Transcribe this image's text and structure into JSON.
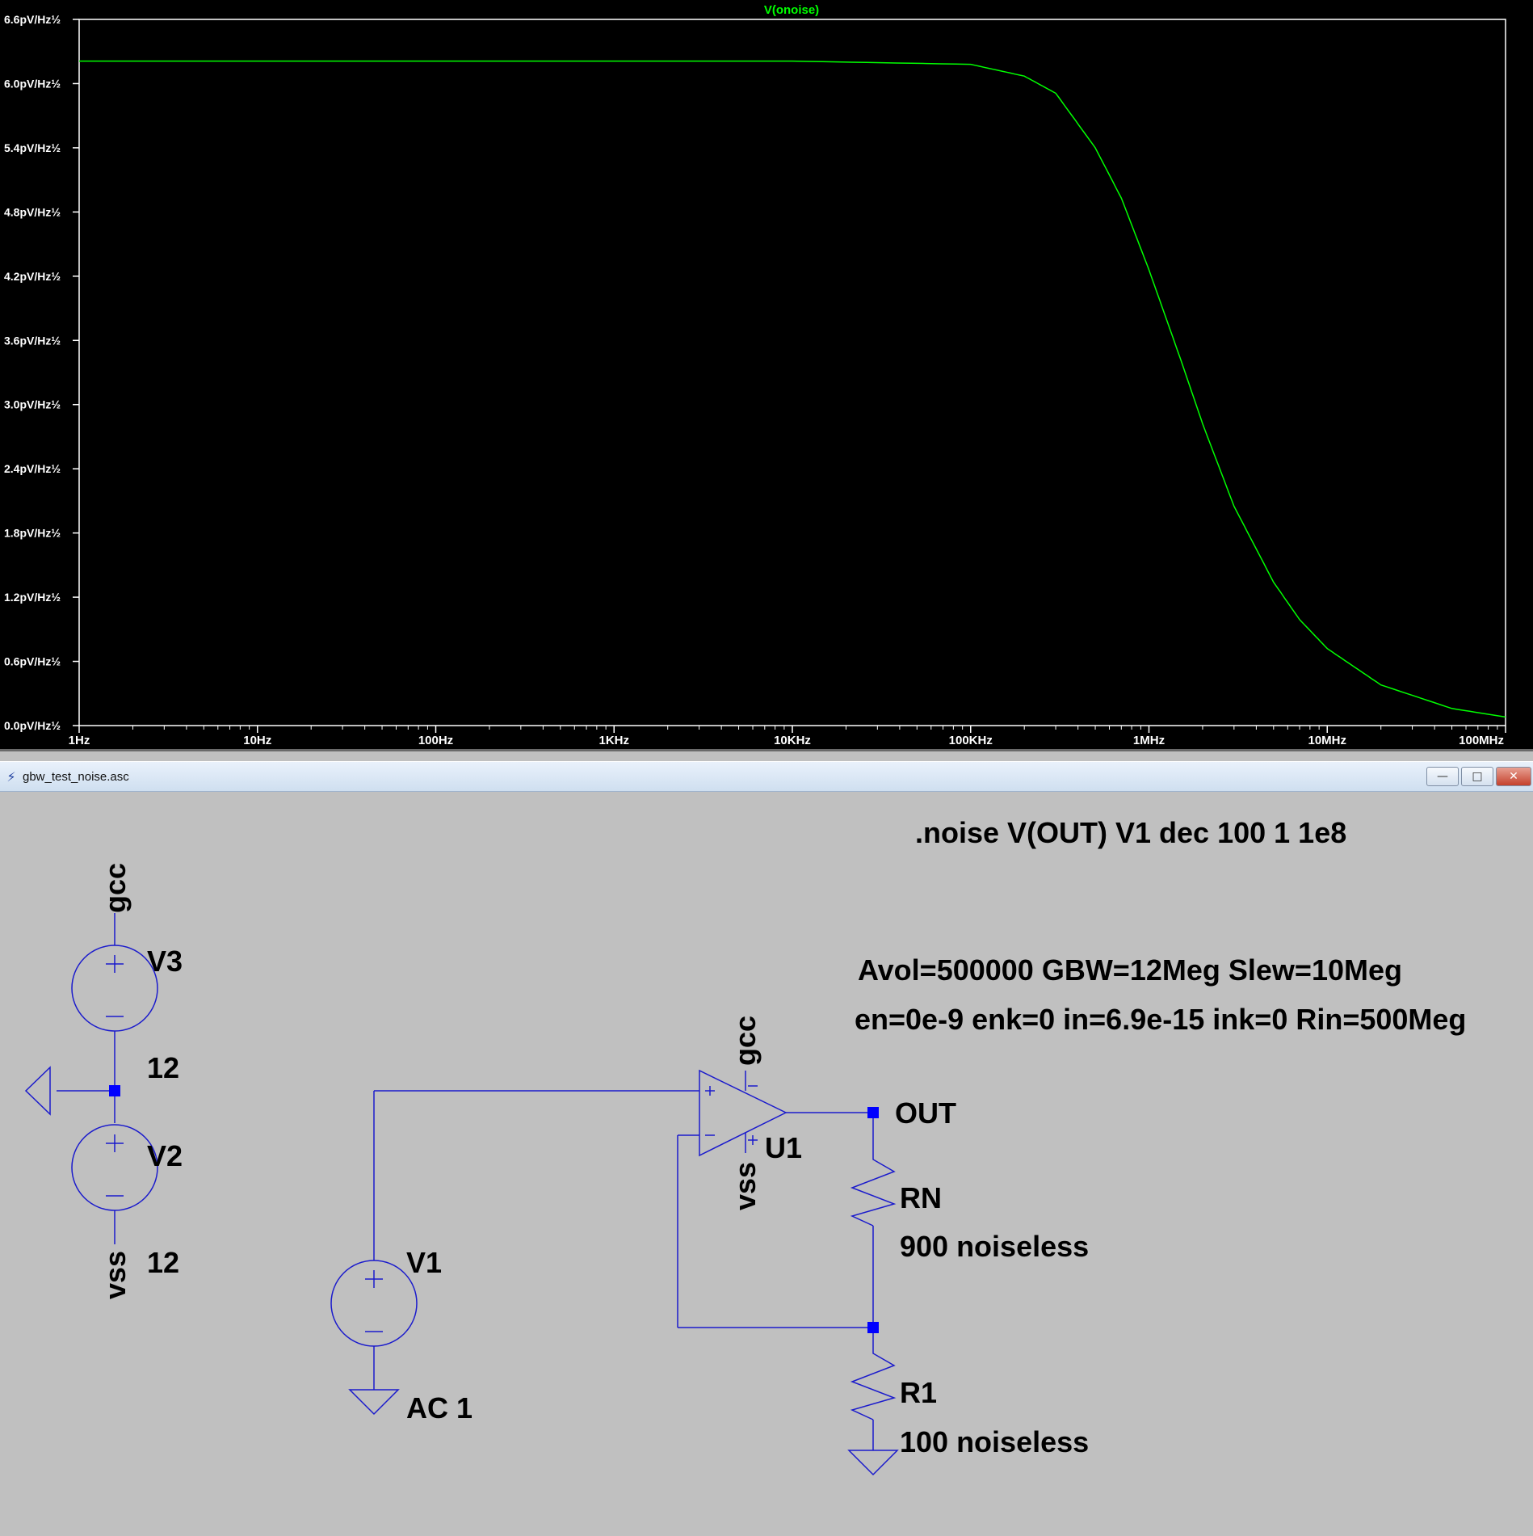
{
  "plot": {
    "trace_label": "V(onoise)",
    "trace_color": "#00ff00",
    "chart_data": {
      "type": "line",
      "title": "V(onoise)",
      "xscale": "log",
      "x_ticks": [
        "1Hz",
        "10Hz",
        "100Hz",
        "1KHz",
        "10KHz",
        "100KHz",
        "1MHz",
        "10MHz",
        "100MHz"
      ],
      "y_ticks": [
        "0.0pV/Hz½",
        "0.6pV/Hz½",
        "1.2pV/Hz½",
        "1.8pV/Hz½",
        "2.4pV/Hz½",
        "3.0pV/Hz½",
        "3.6pV/Hz½",
        "4.2pV/Hz½",
        "4.8pV/Hz½",
        "5.4pV/Hz½",
        "6.0pV/Hz½",
        "6.6pV/Hz½"
      ],
      "xlim_hz": [
        1,
        100000000
      ],
      "ylim_pv": [
        0,
        6.6
      ],
      "grid": false,
      "series": [
        {
          "name": "V(onoise)",
          "x_hz": [
            1,
            10,
            100,
            1000,
            10000,
            100000,
            200000,
            300000,
            500000,
            700000,
            1000000,
            1500000,
            2000000,
            3000000,
            5000000,
            7000000,
            10000000,
            20000000,
            50000000,
            100000000
          ],
          "y_pv": [
            6.21,
            6.21,
            6.21,
            6.21,
            6.21,
            6.18,
            6.07,
            5.91,
            5.4,
            4.93,
            4.26,
            3.43,
            2.82,
            2.05,
            1.34,
            0.99,
            0.72,
            0.38,
            0.16,
            0.08
          ]
        }
      ]
    }
  },
  "schematic": {
    "window_title": "gbw_test_noise.asc",
    "directive": ".noise V(OUT) V1 dec 100 1 1e8",
    "opamp_params_line1": "Avol=500000 GBW=12Meg Slew=10Meg",
    "opamp_params_line2": "en=0e-9 enk=0 in=6.9e-15 ink=0 Rin=500Meg",
    "v3_name": "V3",
    "v3_value": "12",
    "v2_name": "V2",
    "v2_value": "12",
    "v1_name": "V1",
    "v1_value": "AC 1",
    "u1_name": "U1",
    "rn_name": "RN",
    "rn_value": "900 noiseless",
    "r1_name": "R1",
    "r1_value": "100 noiseless",
    "net_out": "OUT",
    "net_gcc_supply": "gcc",
    "net_vss_supply": "vss",
    "net_gcc_opamp": "gcc",
    "net_vss_opamp": "vss",
    "wire_color": "#1a1acc",
    "junction_color": "#0000ff"
  }
}
